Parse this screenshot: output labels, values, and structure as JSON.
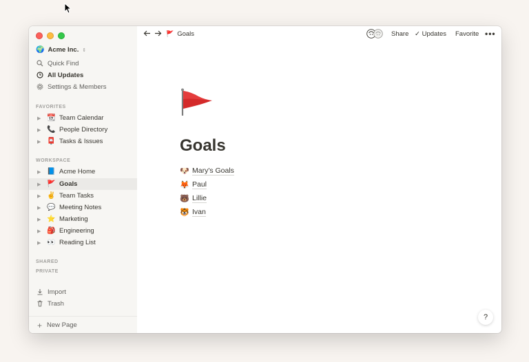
{
  "workspace": {
    "globe_icon": "🌍",
    "name": "Acme Inc.",
    "switcher_icon": "⇕"
  },
  "sidebar": {
    "nav": [
      {
        "label": "Quick Find",
        "icon": "search-icon"
      },
      {
        "label": "All Updates",
        "icon": "clock-icon"
      },
      {
        "label": "Settings & Members",
        "icon": "gear-icon"
      }
    ],
    "favorites_label": "FAVORITES",
    "favorites": [
      {
        "emoji": "📆",
        "label": "Team Calendar"
      },
      {
        "emoji": "📞",
        "label": "People Directory"
      },
      {
        "emoji": "📮",
        "label": "Tasks & Issues"
      }
    ],
    "workspace_label": "WORKSPACE",
    "workspace_pages": [
      {
        "emoji": "📘",
        "label": "Acme Home"
      },
      {
        "emoji": "🚩",
        "label": "Goals"
      },
      {
        "emoji": "✌️",
        "label": "Team Tasks"
      },
      {
        "emoji": "💬",
        "label": "Meeting Notes"
      },
      {
        "emoji": "⭐",
        "label": "Marketing"
      },
      {
        "emoji": "🎒",
        "label": "Engineering"
      },
      {
        "emoji": "👀",
        "label": "Reading List"
      }
    ],
    "active_page": "Goals",
    "shared_label": "SHARED",
    "private_label": "PRIVATE",
    "tools": [
      {
        "label": "Import",
        "icon": "import-icon"
      },
      {
        "label": "Trash",
        "icon": "trash-icon"
      }
    ],
    "new_page_label": "New Page"
  },
  "topbar": {
    "breadcrumb_emoji": "🚩",
    "breadcrumb": "Goals",
    "share": "Share",
    "updates_check": "✓",
    "updates": "Updates",
    "favorite": "Favorite",
    "more": "•••"
  },
  "page": {
    "icon": "🚩",
    "title": "Goals",
    "links": [
      {
        "emoji": "🐶",
        "label": "Mary's Goals"
      },
      {
        "emoji": "🦊",
        "label": "Paul"
      },
      {
        "emoji": "🐻",
        "label": "Lillie"
      },
      {
        "emoji": "🐯",
        "label": "Ivan"
      }
    ]
  },
  "help_label": "?",
  "colors": {
    "sidebar_bg": "#f7f6f3",
    "active_bg": "#ebeae7",
    "text": "#37352f",
    "muted": "#a09f9c",
    "flag_red": "#d42a2a"
  }
}
